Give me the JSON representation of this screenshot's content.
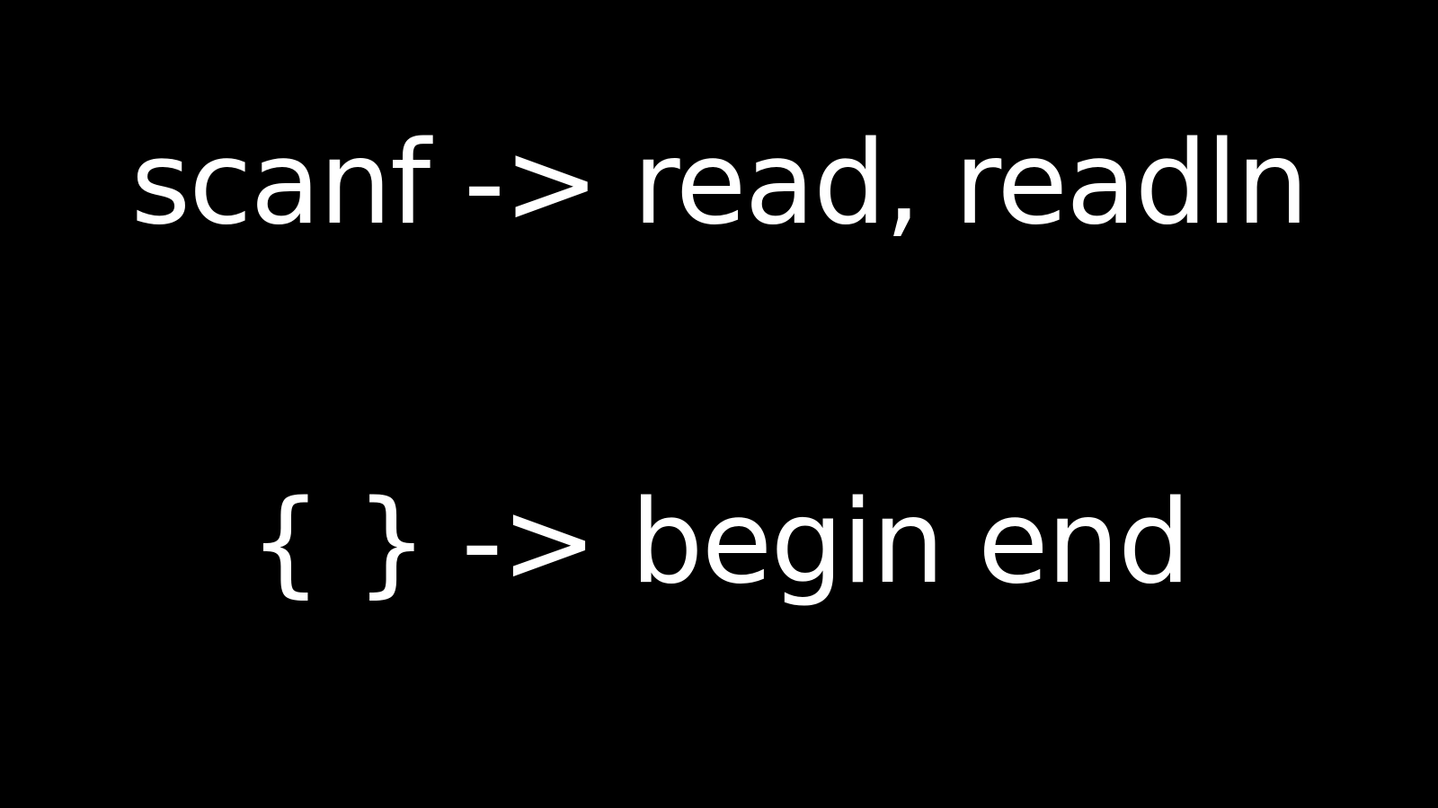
{
  "slide": {
    "lines": [
      "scanf -> read, readln",
      "{ } -> begin end"
    ],
    "background_color": "#000000",
    "text_color": "#ffffff"
  }
}
